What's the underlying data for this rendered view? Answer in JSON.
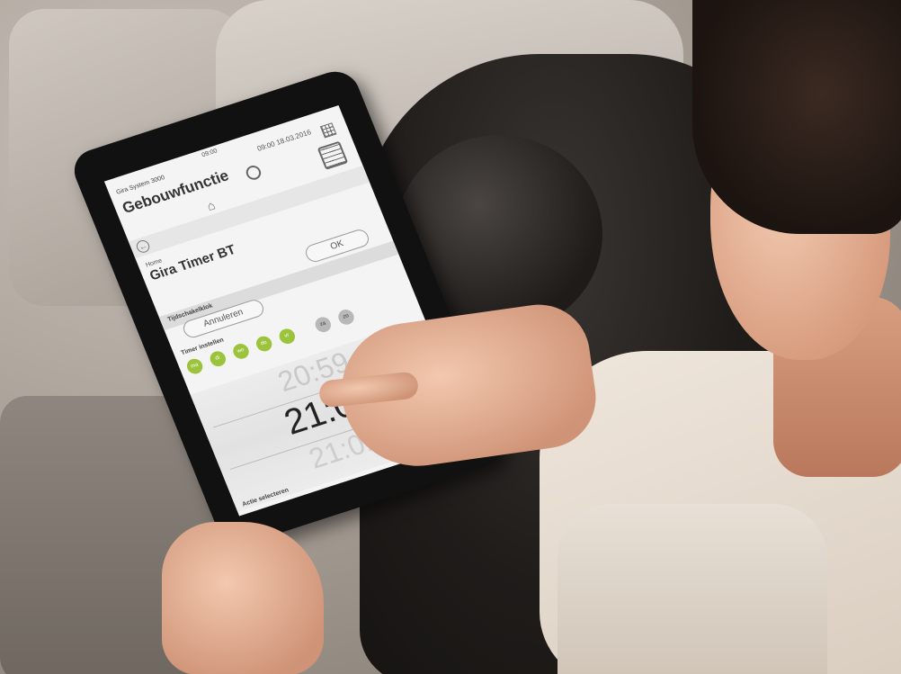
{
  "status_bar": {
    "carrier": "",
    "time": "09:00",
    "right": ""
  },
  "app": {
    "name": "Gira System 3000",
    "page_title": "Gebouwfunctie",
    "header_time": "09:00 18.03.2016"
  },
  "breadcrumb": "Home",
  "device": {
    "title": "Gira Timer BT"
  },
  "buttons": {
    "ok": "OK",
    "cancel": "Annuleren"
  },
  "section": {
    "label": "Tijdschakelklok"
  },
  "timer": {
    "label": "Timer instellen",
    "days": [
      {
        "label": "ma",
        "active": true
      },
      {
        "label": "di",
        "active": true
      },
      {
        "label": "wo",
        "active": true
      },
      {
        "label": "do",
        "active": true
      },
      {
        "label": "vr",
        "active": true
      },
      {
        "label": "za",
        "active": false
      },
      {
        "label": "zo",
        "active": false
      }
    ],
    "time_prev": "20:59",
    "time_current": "21:00",
    "time_next": "21:01"
  },
  "action": {
    "label": "Actie selecteren"
  },
  "colors": {
    "active_day": "#9bc33c",
    "inactive_day": "#b8b8b8"
  },
  "icons": {
    "settings": "settings-icon",
    "home": "home-icon",
    "grid": "grid-icon",
    "room": "room-icon",
    "back": "back-icon"
  }
}
